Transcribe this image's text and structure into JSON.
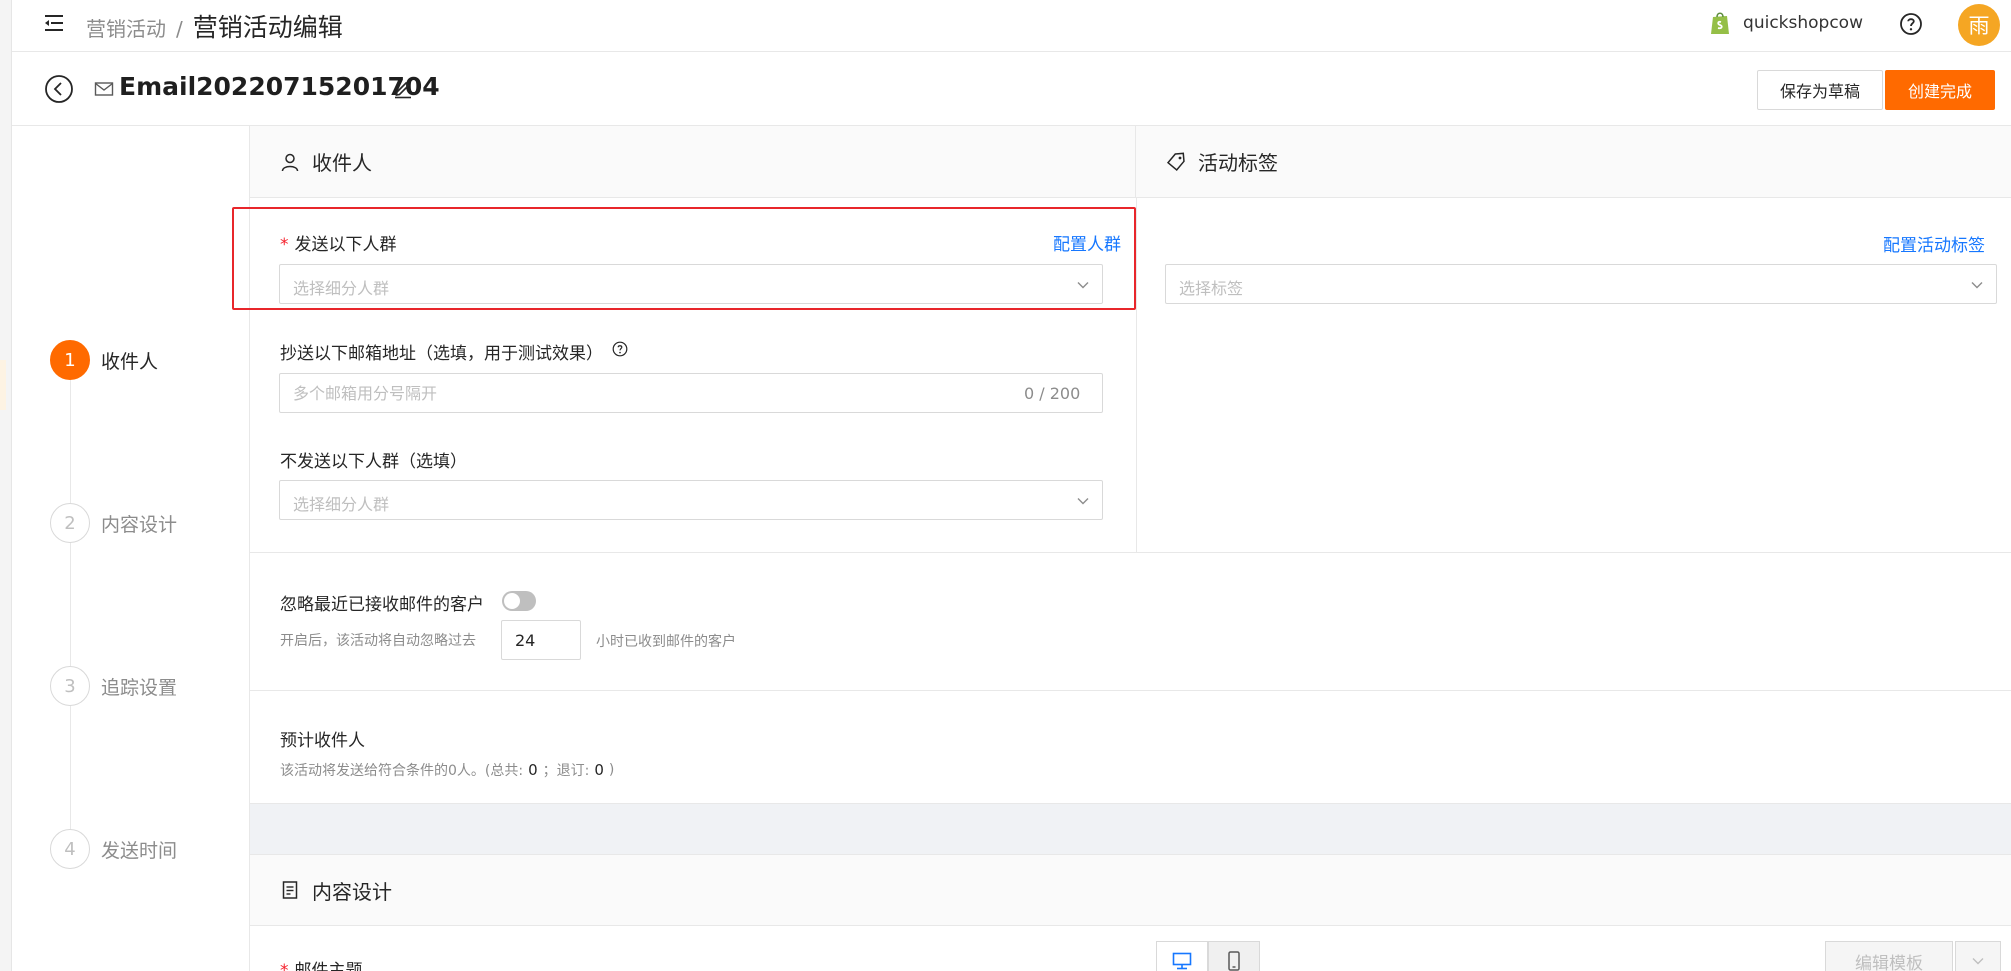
{
  "breadcrumb": {
    "parent": "营销活动",
    "separator": "/",
    "current": "营销活动编辑"
  },
  "shop": {
    "name": "quickshopcow"
  },
  "user": {
    "avatar_char": "雨",
    "avatar_color": "#f5a623"
  },
  "header": {
    "campaign_name": "Email20220715201704",
    "save_draft_label": "保存为草稿",
    "create_label": "创建完成",
    "accent_color": "#ff6a00"
  },
  "steps": [
    {
      "num": "1",
      "label": "收件人",
      "active": true
    },
    {
      "num": "2",
      "label": "内容设计",
      "active": false
    },
    {
      "num": "3",
      "label": "追踪设置",
      "active": false
    },
    {
      "num": "4",
      "label": "发送时间",
      "active": false
    }
  ],
  "recipients": {
    "title": "收件人",
    "required_mark": "*",
    "send_label": "发送以下人群",
    "config_link": "配置人群",
    "segment_placeholder": "选择细分人群",
    "cc_label": "抄送以下邮箱地址（选填，用于测试效果）",
    "cc_placeholder": "多个邮箱用分号隔开",
    "cc_counter": "0 / 200",
    "exclude_label": "不发送以下人群（选填）",
    "exclude_placeholder": "选择细分人群"
  },
  "tags": {
    "title": "活动标签",
    "config_link": "配置活动标签",
    "placeholder": "选择标签"
  },
  "ignore": {
    "label": "忽略最近已接收邮件的客户",
    "toggle_on": false,
    "hint_before": "开启后，该活动将自动忽略过去",
    "hours_value": "24",
    "hint_after": "小时已收到邮件的客户"
  },
  "estimate": {
    "label": "预计收件人",
    "text_prefix": "该活动将发送给符合条件的0人。(总共:",
    "total": "0",
    "sep": "；退订:",
    "unsubscribed": "0",
    "text_suffix": ")"
  },
  "content": {
    "title": "内容设计",
    "subject_label": "邮件主题",
    "edit_template_label": "编辑模板"
  }
}
